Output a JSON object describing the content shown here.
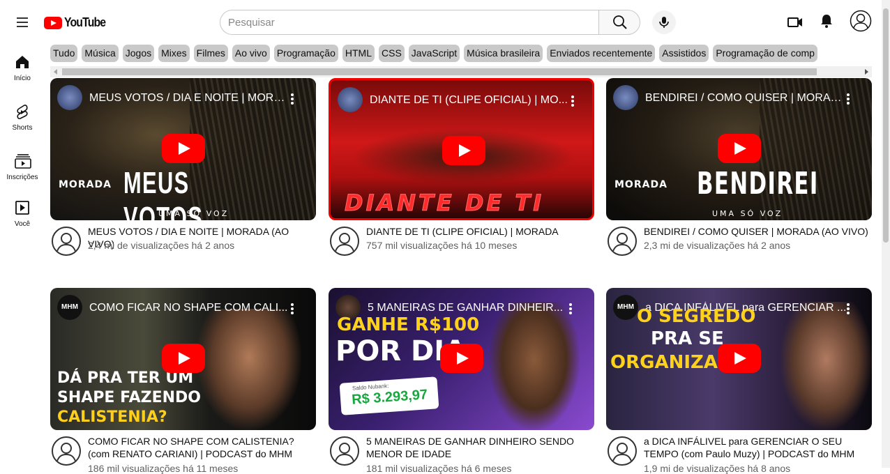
{
  "header": {
    "logo_text": "YouTube",
    "search_placeholder": "Pesquisar"
  },
  "sidebar": {
    "items": [
      {
        "label": "Início",
        "icon": "home-icon"
      },
      {
        "label": "Shorts",
        "icon": "shorts-icon"
      },
      {
        "label": "Inscrições",
        "icon": "subscriptions-icon"
      },
      {
        "label": "Você",
        "icon": "you-icon"
      }
    ]
  },
  "chips": [
    "Tudo",
    "Música",
    "Jogos",
    "Mixes",
    "Filmes",
    "Ao vivo",
    "Programação",
    "HTML",
    "CSS",
    "JavaScript",
    "Música brasileira",
    "Enviados recentemente",
    "Assistidos",
    "Programação de comp"
  ],
  "videos": [
    {
      "thumb_title": "MEUS VOTOS / DIA E NOITE | MORADA...",
      "thumb_text": "MEUS VOTOS",
      "brand": "MORADA",
      "sub": "UMA SÓ VOZ",
      "title": "MEUS VOTOS / DIA E NOITE | MORADA (AO VIVO)",
      "meta": "2,4 mi de visualizações há 2 anos"
    },
    {
      "thumb_title": "DIANTE DE TI (CLIPE OFICIAL) | MO...",
      "thumb_text": "DIANTE DE TI",
      "title": "DIANTE DE TI (CLIPE OFICIAL) | MORADA",
      "meta": "757 mil visualizações há 10 meses"
    },
    {
      "thumb_title": "BENDIREI / COMO QUISER | MORAD...",
      "thumb_text": "BENDIREI",
      "brand": "MORADA",
      "sub": "UMA SÓ VOZ",
      "title": "BENDIREI / COMO QUISER | MORADA (AO VIVO)",
      "meta": "2,3 mi de visualizações há 2 anos"
    },
    {
      "thumb_title": "COMO FICAR NO SHAPE COM CALI...",
      "thumb_text_1": "DÁ PRA TER UM",
      "thumb_text_2": "SHAPE FAZENDO",
      "thumb_text_3": "CALISTENIA?",
      "badge": "MHM",
      "title": "COMO FICAR NO SHAPE COM CALISTENIA? (com RENATO CARIANI) | PODCAST do MHM",
      "meta": "186 mil visualizações há 11 meses"
    },
    {
      "thumb_title": "5 MANEIRAS DE GANHAR DINHEIR...",
      "thumb_text_1": "GANHE R$100",
      "thumb_text_2": "POR DIA",
      "balance_label": "Saldo Nubank:",
      "balance": "R$ 3.293,97",
      "title": "5 MANEIRAS DE GANHAR DINHEIRO SENDO MENOR DE IDADE",
      "meta": "181 mil visualizações há 6 meses"
    },
    {
      "thumb_title": "a DICA INFÁLIVEL para GERENCIAR ...",
      "thumb_text_1": "O SEGREDO",
      "thumb_text_2": "PRA SE",
      "thumb_text_3": "ORGANIZAR”",
      "badge": "MHM",
      "title": "a DICA INFÁLIVEL para GERENCIAR O SEU TEMPO (com Paulo Muzy) | PODCAST do MHM",
      "meta": "1,9 mi de visualizações há 8 anos"
    }
  ],
  "colors": {
    "accent": "#ff0000",
    "chip_bg": "#c9c9c9",
    "meta_text": "#606060"
  }
}
